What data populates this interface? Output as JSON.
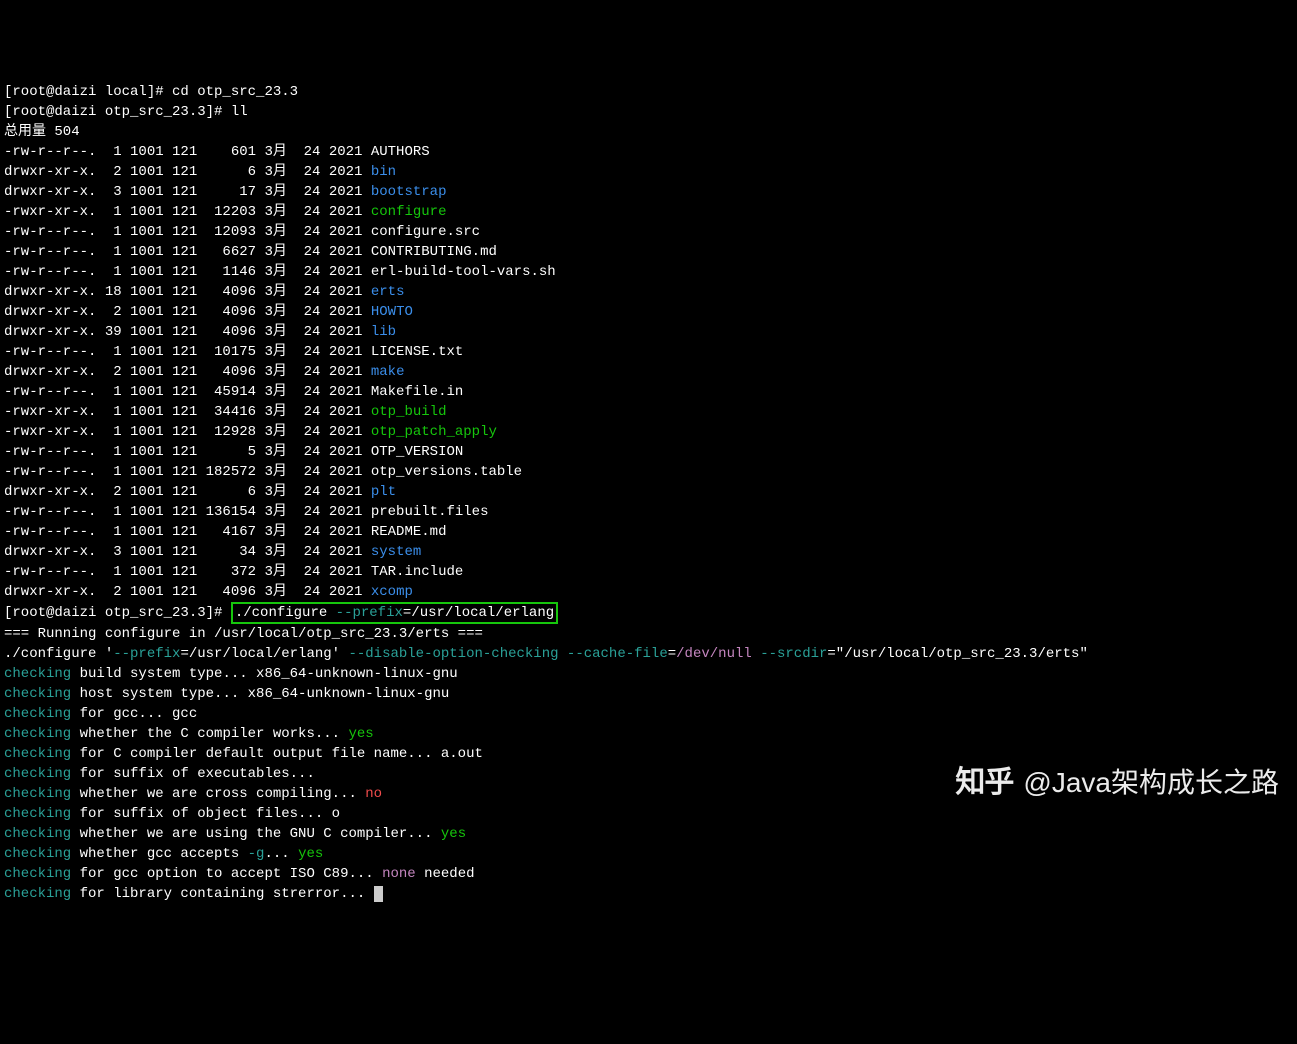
{
  "prompt1": {
    "user": "root",
    "host": "daizi",
    "cwd": "local",
    "cmd": "cd otp_src_23.3"
  },
  "prompt2": {
    "user": "root",
    "host": "daizi",
    "cwd": "otp_src_23.3",
    "cmd": "ll"
  },
  "total_label": "总用量 504",
  "files": [
    {
      "perm": "-rw-r--r--.",
      "n": "1",
      "o": "1001",
      "g": "121",
      "size": "601",
      "m": "3月",
      "d": "24",
      "y": "2021",
      "name": "AUTHORS",
      "dir": false,
      "exe": false
    },
    {
      "perm": "drwxr-xr-x.",
      "n": "2",
      "o": "1001",
      "g": "121",
      "size": "6",
      "m": "3月",
      "d": "24",
      "y": "2021",
      "name": "bin",
      "dir": true,
      "exe": false
    },
    {
      "perm": "drwxr-xr-x.",
      "n": "3",
      "o": "1001",
      "g": "121",
      "size": "17",
      "m": "3月",
      "d": "24",
      "y": "2021",
      "name": "bootstrap",
      "dir": true,
      "exe": false
    },
    {
      "perm": "-rwxr-xr-x.",
      "n": "1",
      "o": "1001",
      "g": "121",
      "size": "12203",
      "m": "3月",
      "d": "24",
      "y": "2021",
      "name": "configure",
      "dir": false,
      "exe": true
    },
    {
      "perm": "-rw-r--r--.",
      "n": "1",
      "o": "1001",
      "g": "121",
      "size": "12093",
      "m": "3月",
      "d": "24",
      "y": "2021",
      "name": "configure.src",
      "dir": false,
      "exe": false
    },
    {
      "perm": "-rw-r--r--.",
      "n": "1",
      "o": "1001",
      "g": "121",
      "size": "6627",
      "m": "3月",
      "d": "24",
      "y": "2021",
      "name": "CONTRIBUTING.md",
      "dir": false,
      "exe": false
    },
    {
      "perm": "-rw-r--r--.",
      "n": "1",
      "o": "1001",
      "g": "121",
      "size": "1146",
      "m": "3月",
      "d": "24",
      "y": "2021",
      "name": "erl-build-tool-vars.sh",
      "dir": false,
      "exe": false
    },
    {
      "perm": "drwxr-xr-x.",
      "n": "18",
      "o": "1001",
      "g": "121",
      "size": "4096",
      "m": "3月",
      "d": "24",
      "y": "2021",
      "name": "erts",
      "dir": true,
      "exe": false
    },
    {
      "perm": "drwxr-xr-x.",
      "n": "2",
      "o": "1001",
      "g": "121",
      "size": "4096",
      "m": "3月",
      "d": "24",
      "y": "2021",
      "name": "HOWTO",
      "dir": true,
      "exe": false
    },
    {
      "perm": "drwxr-xr-x.",
      "n": "39",
      "o": "1001",
      "g": "121",
      "size": "4096",
      "m": "3月",
      "d": "24",
      "y": "2021",
      "name": "lib",
      "dir": true,
      "exe": false
    },
    {
      "perm": "-rw-r--r--.",
      "n": "1",
      "o": "1001",
      "g": "121",
      "size": "10175",
      "m": "3月",
      "d": "24",
      "y": "2021",
      "name": "LICENSE.txt",
      "dir": false,
      "exe": false
    },
    {
      "perm": "drwxr-xr-x.",
      "n": "2",
      "o": "1001",
      "g": "121",
      "size": "4096",
      "m": "3月",
      "d": "24",
      "y": "2021",
      "name": "make",
      "dir": true,
      "exe": false
    },
    {
      "perm": "-rw-r--r--.",
      "n": "1",
      "o": "1001",
      "g": "121",
      "size": "45914",
      "m": "3月",
      "d": "24",
      "y": "2021",
      "name": "Makefile.in",
      "dir": false,
      "exe": false
    },
    {
      "perm": "-rwxr-xr-x.",
      "n": "1",
      "o": "1001",
      "g": "121",
      "size": "34416",
      "m": "3月",
      "d": "24",
      "y": "2021",
      "name": "otp_build",
      "dir": false,
      "exe": true
    },
    {
      "perm": "-rwxr-xr-x.",
      "n": "1",
      "o": "1001",
      "g": "121",
      "size": "12928",
      "m": "3月",
      "d": "24",
      "y": "2021",
      "name": "otp_patch_apply",
      "dir": false,
      "exe": true
    },
    {
      "perm": "-rw-r--r--.",
      "n": "1",
      "o": "1001",
      "g": "121",
      "size": "5",
      "m": "3月",
      "d": "24",
      "y": "2021",
      "name": "OTP_VERSION",
      "dir": false,
      "exe": false
    },
    {
      "perm": "-rw-r--r--.",
      "n": "1",
      "o": "1001",
      "g": "121",
      "size": "182572",
      "m": "3月",
      "d": "24",
      "y": "2021",
      "name": "otp_versions.table",
      "dir": false,
      "exe": false
    },
    {
      "perm": "drwxr-xr-x.",
      "n": "2",
      "o": "1001",
      "g": "121",
      "size": "6",
      "m": "3月",
      "d": "24",
      "y": "2021",
      "name": "plt",
      "dir": true,
      "exe": false
    },
    {
      "perm": "-rw-r--r--.",
      "n": "1",
      "o": "1001",
      "g": "121",
      "size": "136154",
      "m": "3月",
      "d": "24",
      "y": "2021",
      "name": "prebuilt.files",
      "dir": false,
      "exe": false
    },
    {
      "perm": "-rw-r--r--.",
      "n": "1",
      "o": "1001",
      "g": "121",
      "size": "4167",
      "m": "3月",
      "d": "24",
      "y": "2021",
      "name": "README.md",
      "dir": false,
      "exe": false
    },
    {
      "perm": "drwxr-xr-x.",
      "n": "3",
      "o": "1001",
      "g": "121",
      "size": "34",
      "m": "3月",
      "d": "24",
      "y": "2021",
      "name": "system",
      "dir": true,
      "exe": false
    },
    {
      "perm": "-rw-r--r--.",
      "n": "1",
      "o": "1001",
      "g": "121",
      "size": "372",
      "m": "3月",
      "d": "24",
      "y": "2021",
      "name": "TAR.include",
      "dir": false,
      "exe": false
    },
    {
      "perm": "drwxr-xr-x.",
      "n": "2",
      "o": "1001",
      "g": "121",
      "size": "4096",
      "m": "3月",
      "d": "24",
      "y": "2021",
      "name": "xcomp",
      "dir": true,
      "exe": false
    }
  ],
  "prompt3": {
    "user": "root",
    "host": "daizi",
    "cwd": "otp_src_23.3"
  },
  "highlight_cmd": {
    "bin": "./configure ",
    "opt": "--prefix",
    "val": "=/usr/local/erlang"
  },
  "run_line": "=== Running configure in /usr/local/otp_src_23.3/erts ===",
  "cfg_line": {
    "a": "./configure '",
    "b": "--prefix",
    "c": "=/usr/local/erlang' ",
    "d": "--disable-option-checking",
    "e": " ",
    "f": "--cache-file",
    "g": "=",
    "h": "/dev/null",
    "i": " ",
    "j": "--srcdir",
    "k": "=\"/usr/local/otp_src_23.3/erts\""
  },
  "checks": [
    {
      "t": " build system type... x86_64-unknown-linux-gnu"
    },
    {
      "t": " host system type... x86_64-unknown-linux-gnu"
    },
    {
      "t": " for gcc... gcc"
    },
    {
      "t": " whether the C compiler works... ",
      "r": "yes",
      "rc": "green"
    },
    {
      "t": " for C compiler default output file name... a.out"
    },
    {
      "t": " for suffix of executables..."
    },
    {
      "t": " whether we are cross compiling... ",
      "r": "no",
      "rc": "red"
    },
    {
      "t": " for suffix of object files... o"
    },
    {
      "t": " whether we are using the GNU C compiler... ",
      "r": "yes",
      "rc": "green"
    },
    {
      "t": " whether gcc accepts ",
      "mid": "-g",
      "midc": "cyan",
      "post": "... ",
      "r": "yes",
      "rc": "green"
    },
    {
      "t": " for gcc option to accept ISO C89... ",
      "r": "none",
      "rc": "mag",
      "post2": " needed"
    },
    {
      "t": " for library containing strerror... ",
      "cursor": true
    }
  ],
  "checking_label": "checking",
  "watermark": {
    "logo": "知乎",
    "text": "@Java架构成长之路"
  }
}
